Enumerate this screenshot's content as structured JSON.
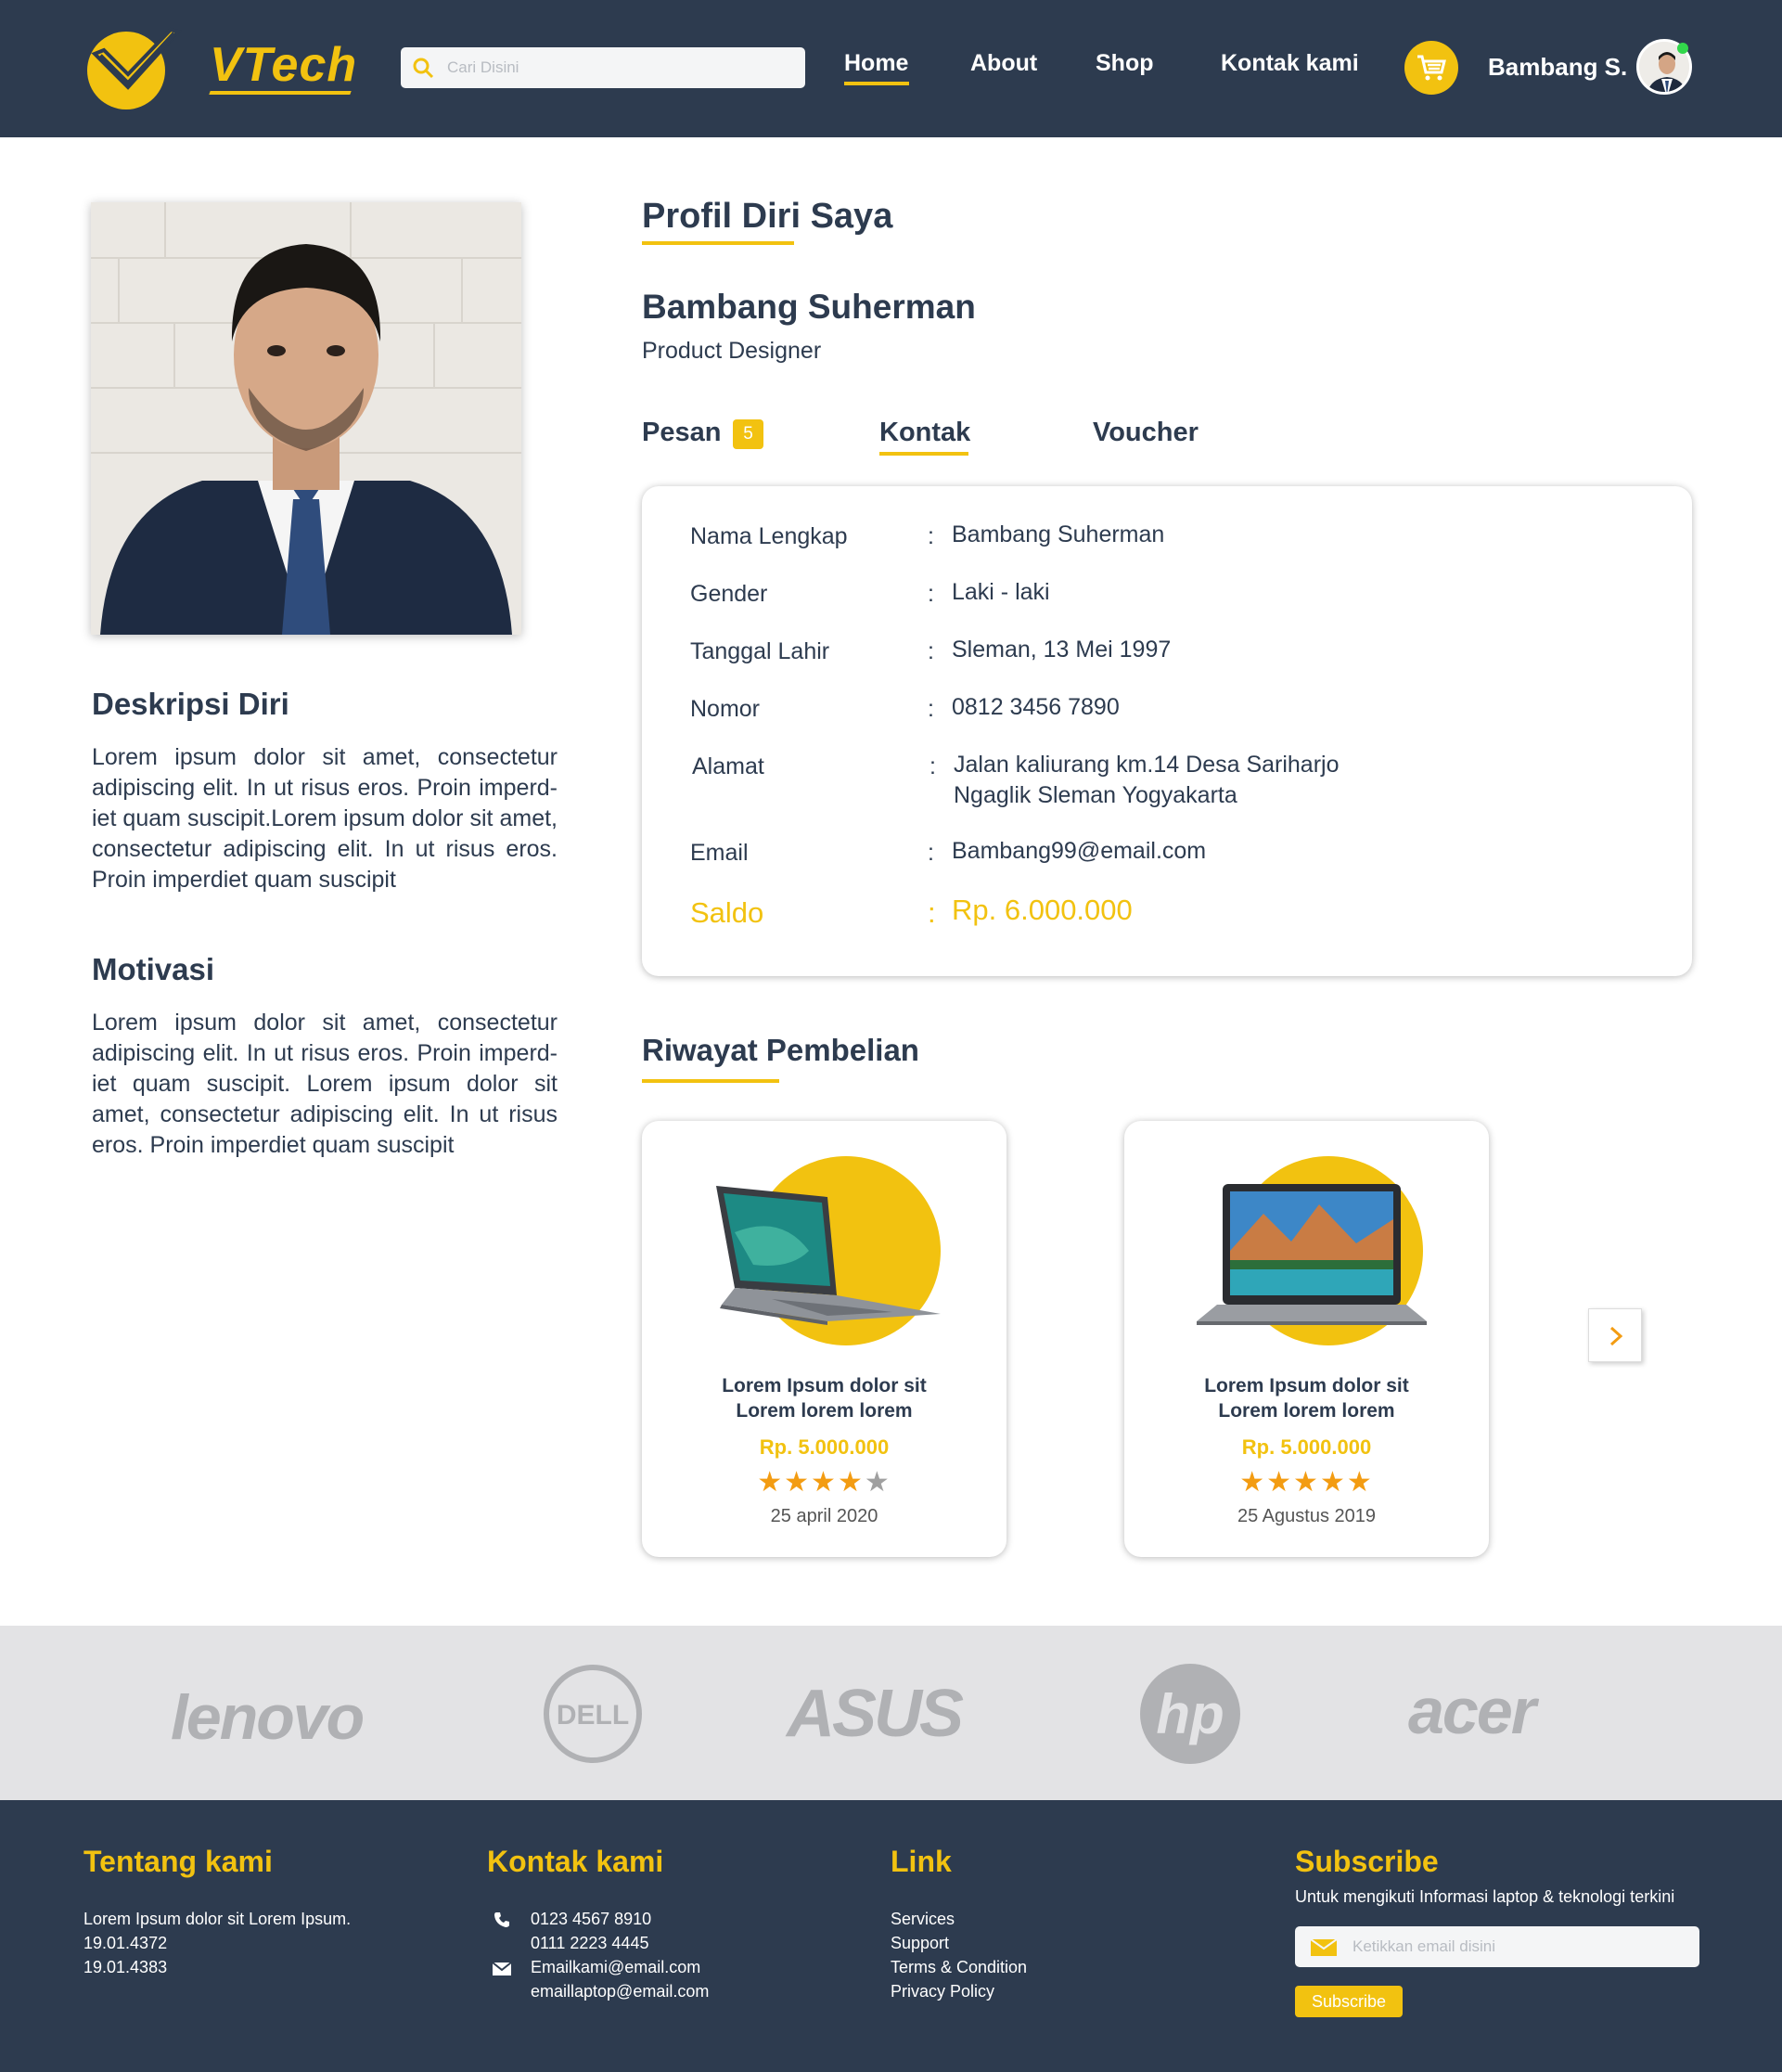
{
  "header": {
    "logo_text": "VTech",
    "search_placeholder": "Cari Disini",
    "nav": [
      "Home",
      "About",
      "Shop",
      "Kontak kami"
    ],
    "active_nav": "Home",
    "user_name": "Bambang S."
  },
  "left": {
    "desc_title": "Deskripsi Diri",
    "desc_text": "Lorem ipsum dolor sit amet, consectetur adipiscing elit. In ut risus eros. Proin imperd-iet quam suscipit.Lorem ipsum dolor sit amet, consectetur adipiscing elit. In ut risus eros. Proin imperdiet quam suscipit",
    "motivasi_title": "Motivasi",
    "motivasi_text": "Lorem ipsum dolor sit amet, consectetur adipiscing elit. In ut risus eros. Proin imperd-iet quam suscipit. Lorem ipsum dolor sit amet, consectetur adipiscing elit. In ut risus eros. Proin imperdiet quam suscipit"
  },
  "profile": {
    "section_title": "Profil Diri Saya",
    "name": "Bambang Suherman",
    "role": "Product Designer",
    "tabs": {
      "pesan": "Pesan",
      "pesan_badge": "5",
      "kontak": "Kontak",
      "voucher": "Voucher"
    },
    "fields": {
      "nama_label": "Nama Lengkap",
      "nama_value": "Bambang Suherman",
      "gender_label": "Gender",
      "gender_value": "Laki - laki",
      "lahir_label": "Tanggal Lahir",
      "lahir_value": "Sleman, 13 Mei 1997",
      "nomor_label": "Nomor",
      "nomor_value": "0812 3456 7890",
      "alamat_label": "Alamat",
      "alamat_line1": "Jalan kaliurang km.14 Desa Sariharjo",
      "alamat_line2": "Ngaglik Sleman Yogyakarta",
      "email_label": "Email",
      "email_value": "Bambang99@email.com",
      "saldo_label": "Saldo",
      "saldo_value": "Rp. 6.000.000",
      "colon": ":"
    }
  },
  "history": {
    "title": "Riwayat Pembelian",
    "items": [
      {
        "name_line1": "Lorem Ipsum dolor sit",
        "name_line2": "Lorem lorem lorem",
        "price": "Rp. 5.000.000",
        "rating": 4,
        "date": "25 april 2020"
      },
      {
        "name_line1": "Lorem Ipsum dolor sit",
        "name_line2": "Lorem lorem lorem",
        "price": "Rp. 5.000.000",
        "rating": 5,
        "date": "25 Agustus 2019"
      }
    ]
  },
  "brands": [
    "lenovo",
    "DELL",
    "ASUS",
    "hp",
    "acer"
  ],
  "footer": {
    "about_title": "Tentang kami",
    "about_lines": [
      "Lorem Ipsum dolor sit Lorem Ipsum.",
      "19.01.4372",
      "19.01.4383"
    ],
    "contact_title": "Kontak kami",
    "phones": [
      "0123 4567 8910",
      "0111 2223 4445"
    ],
    "emails": [
      "Emailkami@email.com",
      "emaillaptop@email.com"
    ],
    "link_title": "Link",
    "links": [
      "Services",
      "Support",
      "Terms & Condition",
      "Privacy Policy"
    ],
    "subscribe_title": "Subscribe",
    "subscribe_desc": "Untuk mengikuti Informasi laptop & teknologi terkini",
    "email_placeholder": "Ketikkan email disini",
    "subscribe_button": "Subscribe"
  },
  "colors": {
    "navy": "#2d3b4f",
    "accent": "#f2c210",
    "star": "#f39c12"
  }
}
